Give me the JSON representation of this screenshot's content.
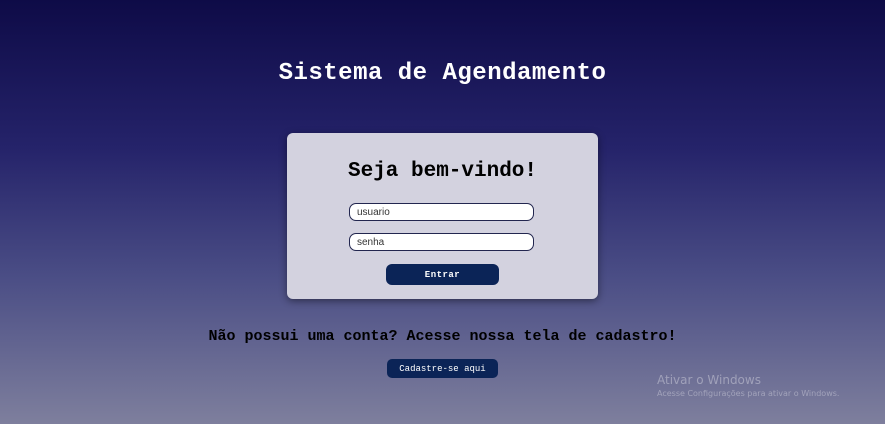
{
  "header": {
    "title": "Sistema de Agendamento"
  },
  "login": {
    "welcome": "Seja bem-vindo!",
    "username_placeholder": "usuario",
    "password_placeholder": "senha",
    "submit_label": "Entrar"
  },
  "signup": {
    "prompt": "Não possui uma conta? Acesse nossa tela de cadastro!",
    "button_label": "Cadastre-se aqui"
  },
  "windows_watermark": {
    "title": "Ativar o Windows",
    "subtitle": "Acesse Configurações para ativar o Windows."
  },
  "colors": {
    "background_top": "#0e0b47",
    "background_bottom": "#7e7f9d",
    "card": "#d3d2df",
    "button": "#0b2457"
  }
}
